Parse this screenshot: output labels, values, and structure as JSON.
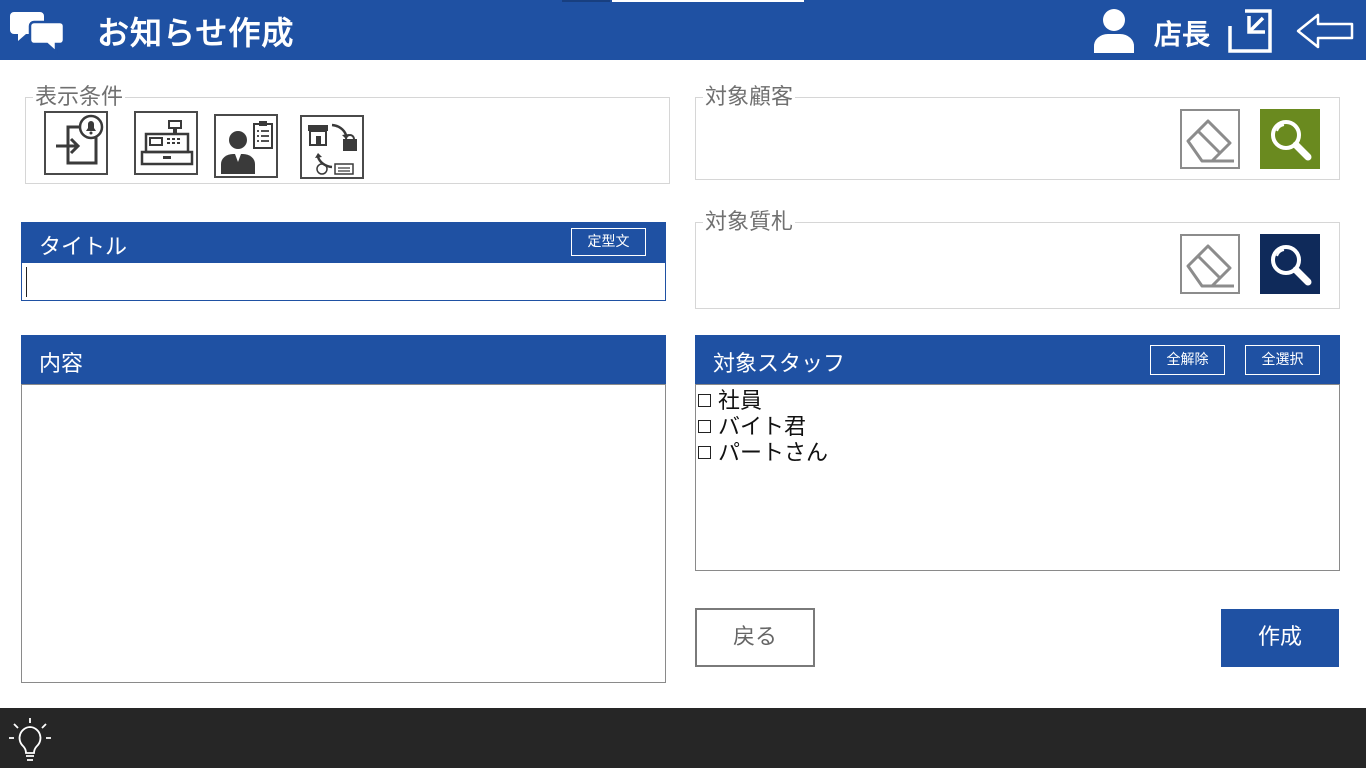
{
  "header": {
    "title": "お知らせ作成",
    "user_name": "店長",
    "icons": [
      "chat-bubbles-icon",
      "user-icon",
      "logout-icon",
      "back-arrow-icon"
    ]
  },
  "conditions": {
    "legend": "表示条件",
    "icons": [
      "login-bell-icon",
      "cash-register-icon",
      "staff-clipboard-icon",
      "store-exchange-icon"
    ]
  },
  "title_section": {
    "label": "タイトル",
    "template_button": "定型文",
    "value": "",
    "placeholder": ""
  },
  "content_section": {
    "label": "内容",
    "value": ""
  },
  "target_customer": {
    "legend": "対象顧客"
  },
  "target_pawn": {
    "legend": "対象質札"
  },
  "target_staff": {
    "label": "対象スタッフ",
    "clear_all": "全解除",
    "select_all": "全選択",
    "items": [
      {
        "label": "社員",
        "checked": false
      },
      {
        "label": "バイト君",
        "checked": false
      },
      {
        "label": "パートさん",
        "checked": false
      }
    ]
  },
  "actions": {
    "back": "戻る",
    "create": "作成"
  },
  "colors": {
    "primary": "#1f51a3",
    "search_green": "#6a8a1f",
    "search_navy": "#0f2a5a",
    "footer": "#262626"
  }
}
